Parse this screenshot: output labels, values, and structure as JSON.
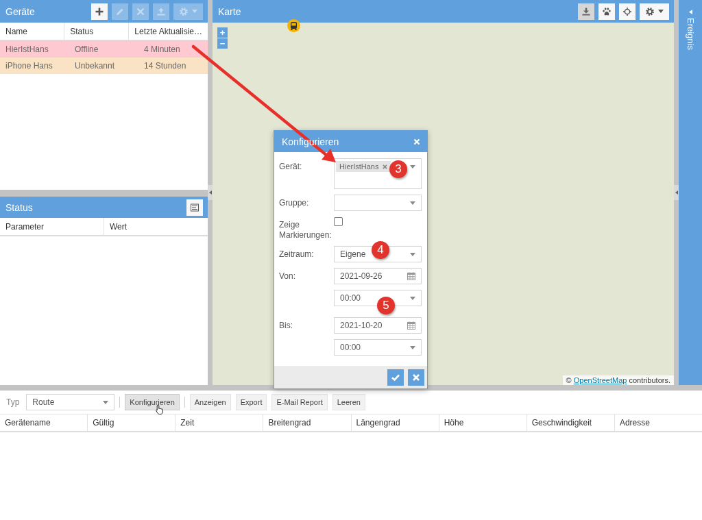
{
  "devices_panel": {
    "title": "Geräte",
    "toolbar": [
      {
        "kind": "add",
        "disabled": false
      },
      {
        "kind": "edit",
        "disabled": true
      },
      {
        "kind": "remove",
        "disabled": true
      },
      {
        "kind": "upload",
        "disabled": true
      },
      {
        "kind": "settings",
        "disabled": true
      }
    ],
    "columns": [
      "Name",
      "Status",
      "Letzte Aktualisie…"
    ],
    "rows": [
      {
        "cells": [
          "HierIstHans",
          "Offline",
          "4 Minuten"
        ],
        "color": "#ffc9d1"
      },
      {
        "cells": [
          "iPhone Hans",
          "Unbekannt",
          "14 Stunden"
        ],
        "color": "#fae3c4"
      }
    ]
  },
  "status_panel": {
    "title": "Status",
    "toolbar": [
      {
        "kind": "list",
        "disabled": false
      }
    ],
    "columns": [
      "Parameter",
      "Wert"
    ]
  },
  "map_panel": {
    "title": "Karte",
    "toolbar": [
      {
        "kind": "download",
        "pressed": true
      },
      {
        "kind": "paw",
        "pressed": false
      },
      {
        "kind": "locate",
        "pressed": false
      },
      {
        "kind": "settings",
        "pressed": false
      }
    ],
    "zoom_controls": [
      "+",
      "−"
    ],
    "attribution": {
      "before": "© ",
      "link": "OpenStreetMap",
      "after": " contributors."
    }
  },
  "event_panel": {
    "title": "Ereignis"
  },
  "dialog": {
    "title": "Konfigurieren",
    "fields": [
      {
        "kind": "tags",
        "label": "Gerät:",
        "tags": [
          "HierIstHans"
        ]
      },
      {
        "kind": "combo",
        "label": "Gruppe:"
      },
      {
        "kind": "checkbox",
        "label": "Zeige Markierungen:",
        "checked": false
      },
      {
        "kind": "combo",
        "label": "Zeitraum:",
        "value": "Eigene"
      },
      {
        "kind": "date",
        "label": "Von:",
        "value": "2021-09-26"
      },
      {
        "kind": "combo",
        "value": "00:00"
      },
      {
        "kind": "date",
        "label": "Bis:",
        "value": "2021-10-20"
      },
      {
        "kind": "combo",
        "value": "00:00"
      }
    ],
    "buttons": [
      {
        "kind": "confirm"
      },
      {
        "kind": "cancel"
      }
    ]
  },
  "report_toolbar": {
    "type_label": "Typ",
    "type_value": "Route",
    "buttons": [
      {
        "label": "Konfigurieren",
        "pressed": true
      },
      {
        "label": "Anzeigen",
        "pressed": false
      },
      {
        "label": "Export",
        "pressed": false
      },
      {
        "label": "E-Mail Report",
        "pressed": false
      },
      {
        "label": "Leeren",
        "pressed": false
      }
    ]
  },
  "report_table": {
    "columns": [
      "Gerätename",
      "Gültig",
      "Zeit",
      "Breitengrad",
      "Längengrad",
      "Höhe",
      "Geschwindigkeit",
      "Adresse"
    ]
  },
  "annotations": [
    {
      "label": "3"
    },
    {
      "label": "4"
    },
    {
      "label": "5"
    }
  ]
}
